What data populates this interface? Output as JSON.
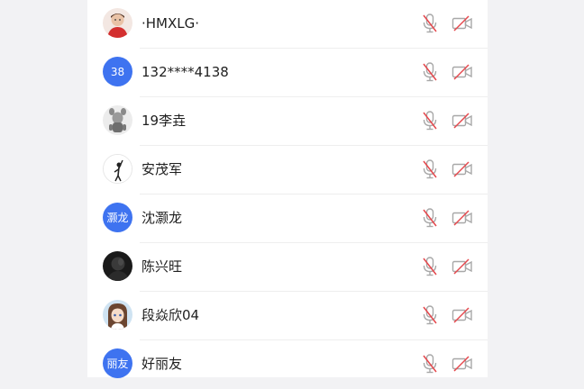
{
  "participants": [
    {
      "name": "·HMXLG·",
      "avatar_type": "photo",
      "avatar_desc": "child-red-outfit",
      "mic": "muted",
      "camera": "off"
    },
    {
      "name": "132****4138",
      "avatar_type": "text",
      "avatar_text": "38",
      "mic": "muted",
      "camera": "off"
    },
    {
      "name": "19李垚",
      "avatar_type": "photo",
      "avatar_desc": "cartoon-figure-gray",
      "mic": "muted",
      "camera": "off"
    },
    {
      "name": "安茂军",
      "avatar_type": "photo",
      "avatar_desc": "figure-sketch-white",
      "mic": "muted",
      "camera": "off"
    },
    {
      "name": "沈灏龙",
      "avatar_type": "text",
      "avatar_text": "灏龙",
      "mic": "muted",
      "camera": "off"
    },
    {
      "name": "陈兴旺",
      "avatar_type": "photo",
      "avatar_desc": "silhouette-dark",
      "mic": "muted",
      "camera": "off"
    },
    {
      "name": "段焱欣04",
      "avatar_type": "photo",
      "avatar_desc": "anime-girl",
      "mic": "muted",
      "camera": "off"
    },
    {
      "name": "好丽友",
      "avatar_type": "text",
      "avatar_text": "丽友",
      "mic": "muted",
      "camera": "off"
    }
  ],
  "colors": {
    "avatar_blue": "#3e73f0",
    "muted_icon_gray": "#a8a8a8",
    "muted_slash_red": "#e5484d"
  }
}
